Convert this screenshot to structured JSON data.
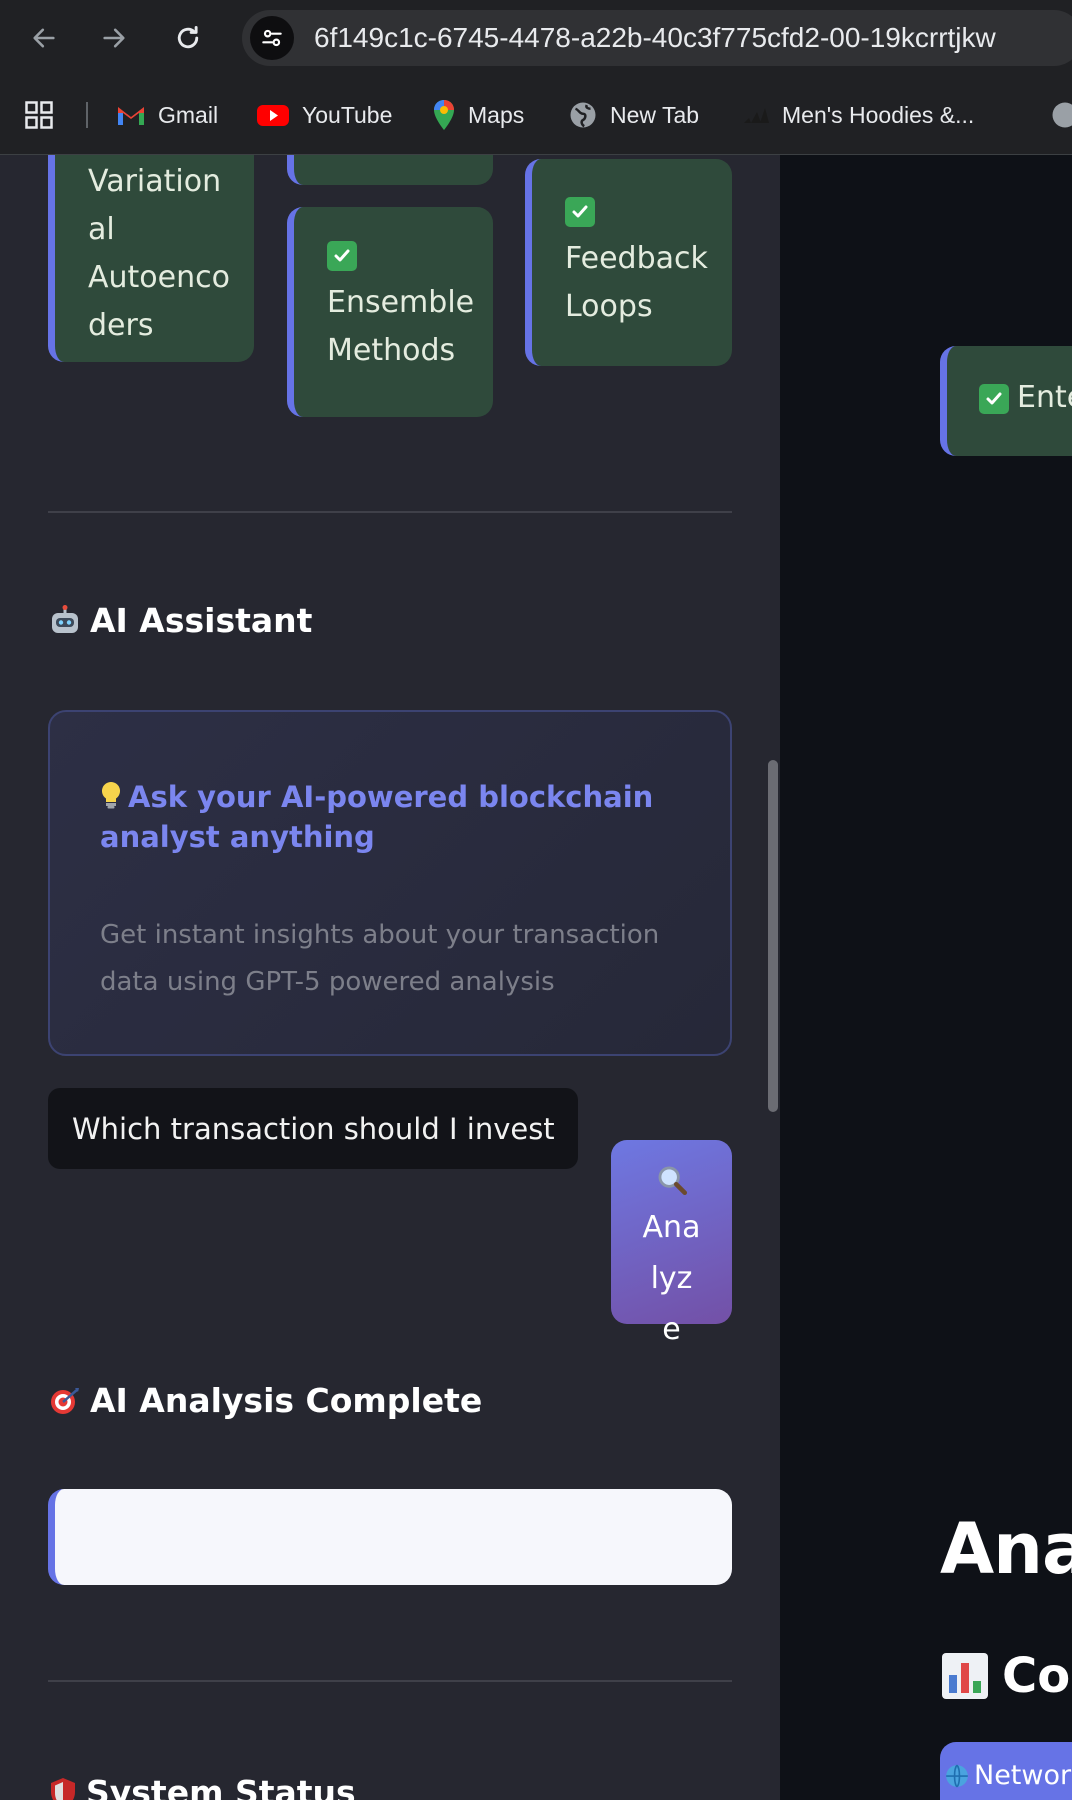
{
  "browser": {
    "url": "6f149c1c-6745-4478-a22b-40c3f775cfd2-00-19kcrrtjkw",
    "bookmarks": [
      {
        "label": "Gmail",
        "icon": "gmail-icon"
      },
      {
        "label": "YouTube",
        "icon": "youtube-icon"
      },
      {
        "label": "Maps",
        "icon": "maps-icon"
      },
      {
        "label": "New Tab",
        "icon": "globe-icon"
      },
      {
        "label": "Men's Hoodies &...",
        "icon": "adidas-icon"
      }
    ]
  },
  "sidebar": {
    "features": [
      {
        "label": "Variation al Autoenco ders"
      },
      {
        "label": "Ensemble Methods"
      },
      {
        "label": "Feedback Loops"
      }
    ],
    "ai_assistant": {
      "title": "AI Assistant",
      "prompt_heading": "Ask your AI-powered blockchain analyst anything",
      "prompt_sub": "Get instant insights about your transaction data using GPT-5 powered analysis",
      "query_value": "Which transaction should I investigate",
      "analyze_label": "Analyze"
    },
    "analysis": {
      "title": "AI Analysis Complete",
      "result": ""
    },
    "system_status": {
      "title": "System Status"
    }
  },
  "main": {
    "feature_partial": "Ente",
    "heading_partial": "Anal",
    "subheading_partial": "Co",
    "tab_partial": "Network"
  },
  "colors": {
    "accent": "#6673e6",
    "feature_bg": "#2f4a3b",
    "sidebar_bg": "#262730",
    "main_bg": "#0e1117"
  }
}
